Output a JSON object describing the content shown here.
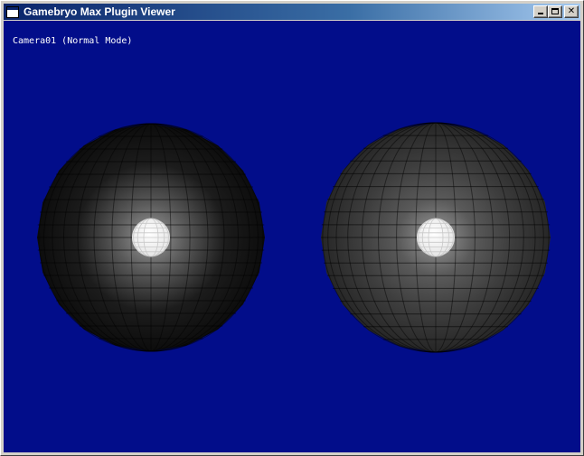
{
  "window": {
    "title": "Gamebryo Max Plugin Viewer",
    "icon": "window-icon",
    "buttons": {
      "minimize": "minimize-icon",
      "maximize": "maximize-icon",
      "close_glyph": "✕"
    }
  },
  "viewport": {
    "background_color": "#020d8a",
    "camera_label": "Camera01 (Normal Mode)",
    "objects": [
      {
        "name": "sphere-left",
        "body_color": "#1c1c1c",
        "rim_color": "#0c0c0c",
        "highlight_color": "#ffffff"
      },
      {
        "name": "sphere-right",
        "body_color": "#3e3e3e",
        "rim_color": "#262626",
        "highlight_color": "#ffffff"
      }
    ]
  }
}
